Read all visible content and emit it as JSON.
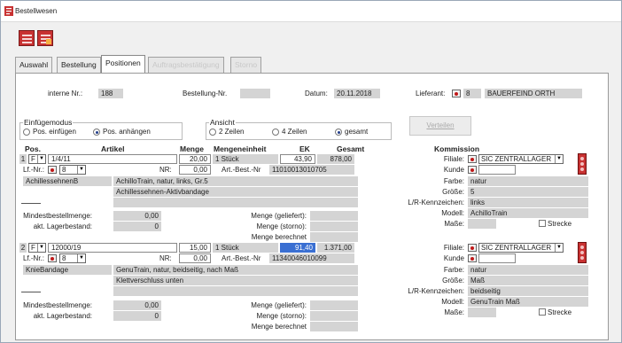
{
  "window": {
    "title": "Bestellwesen"
  },
  "tabs": [
    {
      "label": "Auswahl",
      "state": "normal"
    },
    {
      "label": "Bestellung",
      "state": "normal"
    },
    {
      "label": "Positionen",
      "state": "active"
    },
    {
      "label": "Auftragsbestätigung",
      "state": "disabled"
    },
    {
      "label": "Storno",
      "state": "disabled"
    }
  ],
  "header": {
    "interne_nr_label": "interne Nr.:",
    "interne_nr": "188",
    "bestellung_nr_label": "Bestellung-Nr.",
    "bestellung_nr": "",
    "datum_label": "Datum:",
    "datum": "20.11.2018",
    "lieferant_label": "Lieferant:",
    "lieferant_nr": "8",
    "lieferant_name": "BAUERFEIND ORTH"
  },
  "einfuegemodus": {
    "title": "Einfügemodus",
    "options": [
      "Pos. einfügen",
      "Pos. anhängen"
    ],
    "selected": "Pos. anhängen"
  },
  "ansicht": {
    "title": "Ansicht",
    "options": [
      "2 Zeilen",
      "4 Zeilen",
      "gesamt"
    ],
    "selected": "gesamt"
  },
  "verteilen_label": "Verteilen",
  "columns": {
    "pos": "Pos.",
    "artikel": "Artikel",
    "menge": "Menge",
    "mengeneinheit": "Mengeneinheit",
    "ek": "EK",
    "gesamt": "Gesamt",
    "kommission": "Kommission"
  },
  "labels": {
    "lf_nr": "Lf.-Nr.:",
    "nr": "NR:",
    "art_best_nr": "Art.-Best.-Nr",
    "mindestbestellmenge": "Mindestbestellmenge:",
    "lagerbestand": "akt. Lagerbestand:",
    "menge_geliefert": "Menge (geliefert):",
    "menge_storno": "Menge (storno):",
    "menge_berechnet": "Menge berechnet",
    "filiale": "Filiale:",
    "kunde": "Kunde",
    "farbe": "Farbe:",
    "groesse": "Größe:",
    "lr_kennzeichen": "L/R-Kennzeichen:",
    "modell": "Modell:",
    "masse": "Maße:",
    "strecke": "Strecke"
  },
  "positions": [
    {
      "no": "1",
      "type": "F",
      "artikel": "1/4/11",
      "menge": "20,00",
      "einheit": "1 Stück",
      "ek": "43,90",
      "gesamt": "878,00",
      "lf_nr": "8",
      "nr": "0,00",
      "art_best_nr": "11010013010705",
      "kurzname": "AchillessehnenB",
      "beschreibung1": "AchilloTrain, natur, links, Gr.5",
      "beschreibung2": "Achillessehnen-Aktivbandage",
      "mindestbestellmenge": "0,00",
      "lagerbestand": "0",
      "filiale": "SIC ZENTRALLAGER",
      "kunde": "",
      "farbe": "natur",
      "groesse": "5",
      "lr_kennzeichen": "links",
      "modell": "AchilloTrain",
      "masse": ""
    },
    {
      "no": "2",
      "type": "F",
      "artikel": "12000/19",
      "menge": "15,00",
      "einheit": "1 Stück",
      "ek": "91,40",
      "gesamt": "1.371,00",
      "lf_nr": "8",
      "nr": "0,00",
      "art_best_nr": "11340046010099",
      "kurzname": "KnieBandage",
      "beschreibung1": "GenuTrain, natur, beidseitig, nach Maß",
      "beschreibung2": "Klettverschluss unten",
      "mindestbestellmenge": "0,00",
      "lagerbestand": "0",
      "filiale": "SIC ZENTRALLAGER",
      "kunde": "",
      "farbe": "natur",
      "groesse": "Maß",
      "lr_kennzeichen": "beidseitig",
      "modell": "GenuTrain Maß",
      "masse": ""
    }
  ],
  "colors": {
    "accent": "#c83232",
    "selection": "#3a6fd2",
    "field": "#d4d4d4"
  }
}
